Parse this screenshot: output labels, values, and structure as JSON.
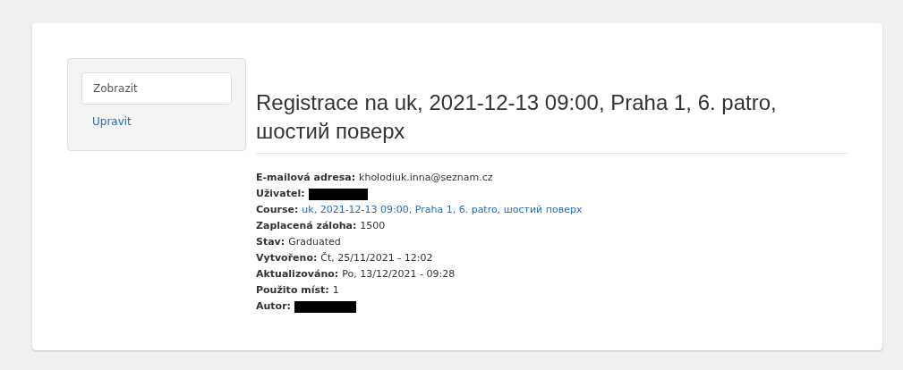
{
  "tabs": [
    {
      "label": "Zobrazit",
      "selected": true
    },
    {
      "label": "Upravit",
      "selected": false
    }
  ],
  "title": "Registrace na uk, 2021-12-13 09:00, Praha 1, 6. patro, шостий поверх",
  "fields": [
    {
      "label": "E-mailová adresa:",
      "kind": "text",
      "value": "kholodiuk.inna@seznam.cz"
    },
    {
      "label": "Uživatel:",
      "kind": "redacted"
    },
    {
      "label": "Course:",
      "kind": "link",
      "value": "uk, 2021-12-13 09:00, Praha 1, 6. patro, шостий поверх"
    },
    {
      "label": "Zaplacená záloha:",
      "kind": "text",
      "value": "1500"
    },
    {
      "label": "Stav:",
      "kind": "text",
      "value": "Graduated"
    },
    {
      "label": "Vytvořeno:",
      "kind": "text",
      "value": "Čt, 25/11/2021 - 12:02"
    },
    {
      "label": "Aktualizováno:",
      "kind": "text",
      "value": "Po, 13/12/2021 - 09:28"
    },
    {
      "label": "Použito míst:",
      "kind": "text",
      "value": "1"
    },
    {
      "label": "Autor:",
      "kind": "redacted"
    }
  ]
}
